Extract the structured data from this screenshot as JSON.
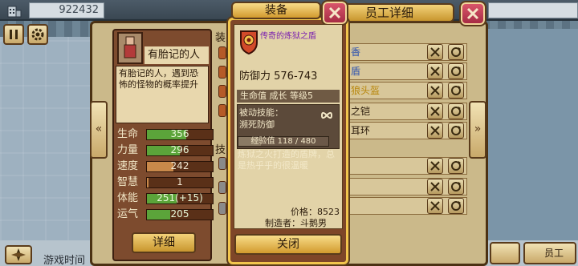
{
  "top_bar": {
    "money": "922432"
  },
  "staff_window": {
    "title_visible": "员工详细"
  },
  "character": {
    "name": "有胎记的人",
    "description": "有胎记的人，遇到恐怖的怪物的概率提升"
  },
  "stats": [
    {
      "label": "生命",
      "value": "356",
      "fill": 0.6,
      "color": "green"
    },
    {
      "label": "力量",
      "value": "296",
      "fill": 0.5,
      "color": "green"
    },
    {
      "label": "速度",
      "value": "242",
      "fill": 0.4,
      "color": "orange"
    },
    {
      "label": "智慧",
      "value": "1",
      "fill": 0.02,
      "color": "orange"
    },
    {
      "label": "体能",
      "value": "251(+15)",
      "fill": 0.45,
      "color": "green"
    },
    {
      "label": "运气",
      "value": "205",
      "fill": 0.35,
      "color": "green"
    }
  ],
  "detail_button": "详细",
  "equipment_column": {
    "header_partial": "装",
    "skills_header_partial": "技",
    "slots_visible": [
      "香",
      "盾",
      "狼头盔",
      "之铠",
      "耳环"
    ]
  },
  "equip_popup": {
    "title": "装备",
    "item_name": "传奇的炼狱之盾",
    "defense": "防御力 576-743",
    "growth_line": "生命值  成长  等级5",
    "skill_label": "被动技能：",
    "skill_name": "濒死防御",
    "exp_text": "经验值 118 / 480",
    "exp_fraction": 0.246,
    "description": "炼狱之火打造的盾牌，总是热乎乎的很温暖",
    "price": "价格：8523",
    "maker": "制造者：斗鹅男",
    "close_button": "关闭"
  },
  "bottom_bar": {
    "game_time_label": "游戏时间",
    "staff_button": "员工"
  },
  "colors": {
    "close_red": "#c23e56",
    "gold_button": "#e6b54a",
    "panel_brown": "#7e4628",
    "item_name_purple": "#7a1fb0"
  }
}
